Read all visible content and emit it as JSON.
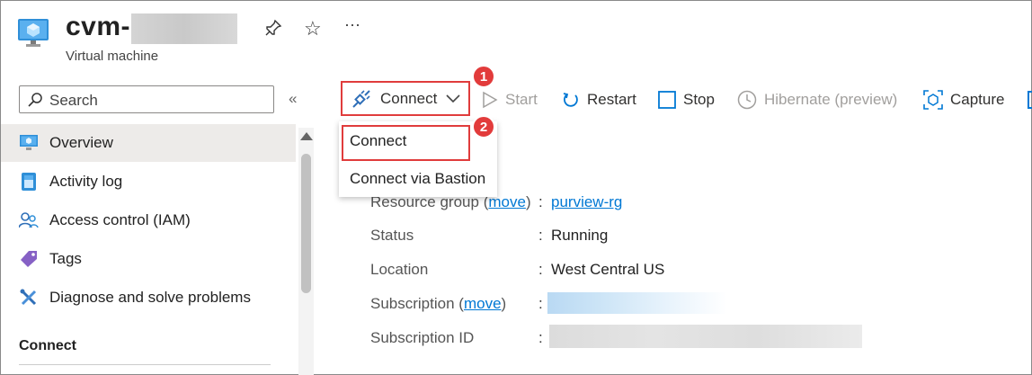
{
  "header": {
    "title": "cvm-",
    "subtitle": "Virtual machine",
    "pin_icon": "pin-icon",
    "star_icon": "star-icon",
    "more_label": "···"
  },
  "sidebar": {
    "search_placeholder": "Search",
    "collapse_label": "«",
    "items": [
      {
        "label": "Overview",
        "icon": "vm-monitor-icon",
        "selected": true
      },
      {
        "label": "Activity log",
        "icon": "activity-log-icon"
      },
      {
        "label": "Access control (IAM)",
        "icon": "people-icon"
      },
      {
        "label": "Tags",
        "icon": "tag-icon"
      },
      {
        "label": "Diagnose and solve problems",
        "icon": "wrench-icon"
      }
    ],
    "section_connect": "Connect"
  },
  "toolbar": {
    "connect": "Connect",
    "start": "Start",
    "restart": "Restart",
    "stop": "Stop",
    "hibernate": "Hibernate (preview)",
    "capture": "Capture"
  },
  "connect_menu": {
    "items": [
      "Connect",
      "Connect via Bastion"
    ]
  },
  "badges": {
    "one": "1",
    "two": "2"
  },
  "properties": {
    "resource_group_label": "Resource group",
    "move_link": "move",
    "resource_group_value": "purview-rg",
    "status_label": "Status",
    "status_value": "Running",
    "location_label": "Location",
    "location_value": "West Central US",
    "subscription_label": "Subscription",
    "subscription_id_label": "Subscription ID",
    "separator": ":"
  },
  "colors": {
    "accent": "#0078d4",
    "highlight": "#e03c3c",
    "selected_bg": "#edebe9"
  }
}
